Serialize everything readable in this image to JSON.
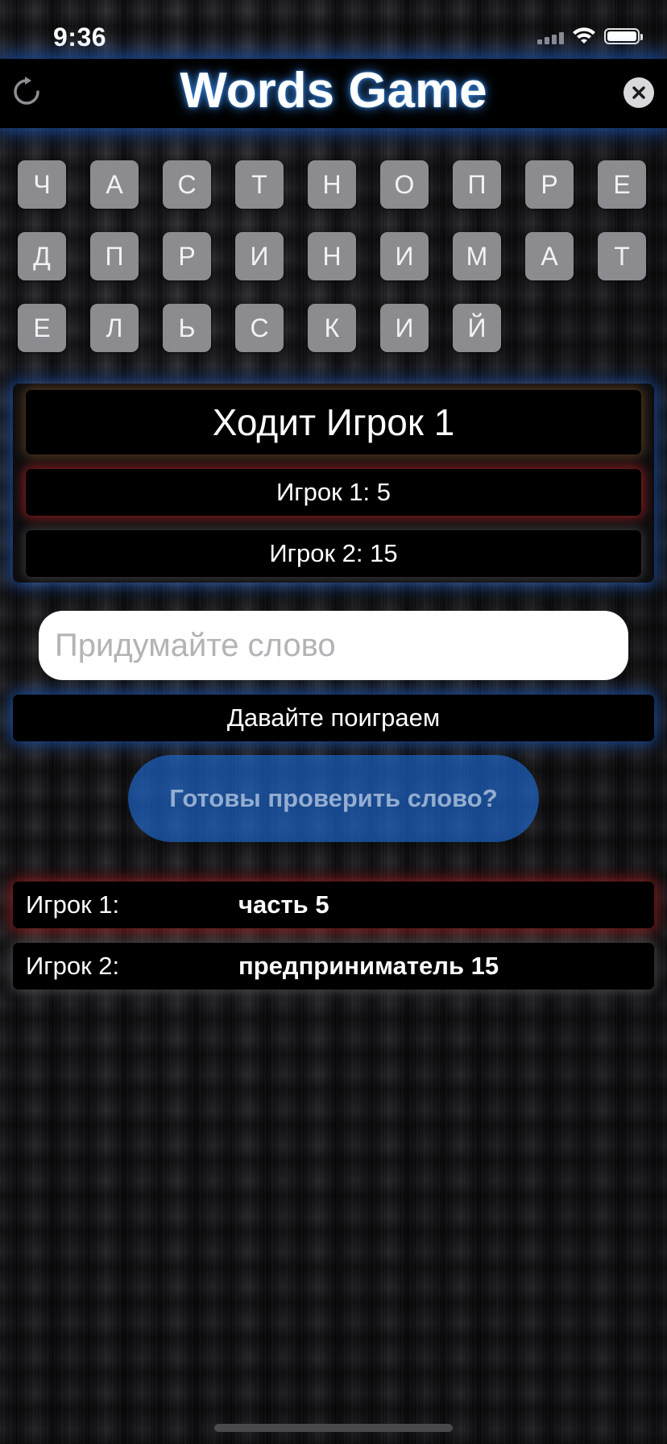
{
  "status_bar": {
    "time": "9:36"
  },
  "header": {
    "title": "Words Game",
    "left_icon": "refresh-icon",
    "right_icon": "close-icon"
  },
  "tiles": [
    "Ч",
    "А",
    "С",
    "Т",
    "Н",
    "О",
    "П",
    "Р",
    "Е",
    "Д",
    "П",
    "Р",
    "И",
    "Н",
    "И",
    "М",
    "А",
    "Т",
    "Е",
    "Л",
    "Ь",
    "С",
    "К",
    "И",
    "Й"
  ],
  "turn_panel": {
    "current_turn": "Ходит Игрок 1",
    "player1_score": "Игрок 1: 5",
    "player2_score": "Игрок 2: 15"
  },
  "word_input": {
    "value": "",
    "placeholder": "Придумайте слово"
  },
  "message": "Давайте поиграем",
  "check_button_label": "Готовы проверить слово?",
  "history": [
    {
      "label": "Игрок 1:",
      "word": "часть 5"
    },
    {
      "label": "Игрок 2:",
      "word": "предприниматель 15"
    }
  ],
  "colors": {
    "glow_blue": "#2878ff",
    "glow_red": "#dc2828",
    "tile_gray": "#8c8c90",
    "button_blue": "#1e6edc"
  }
}
